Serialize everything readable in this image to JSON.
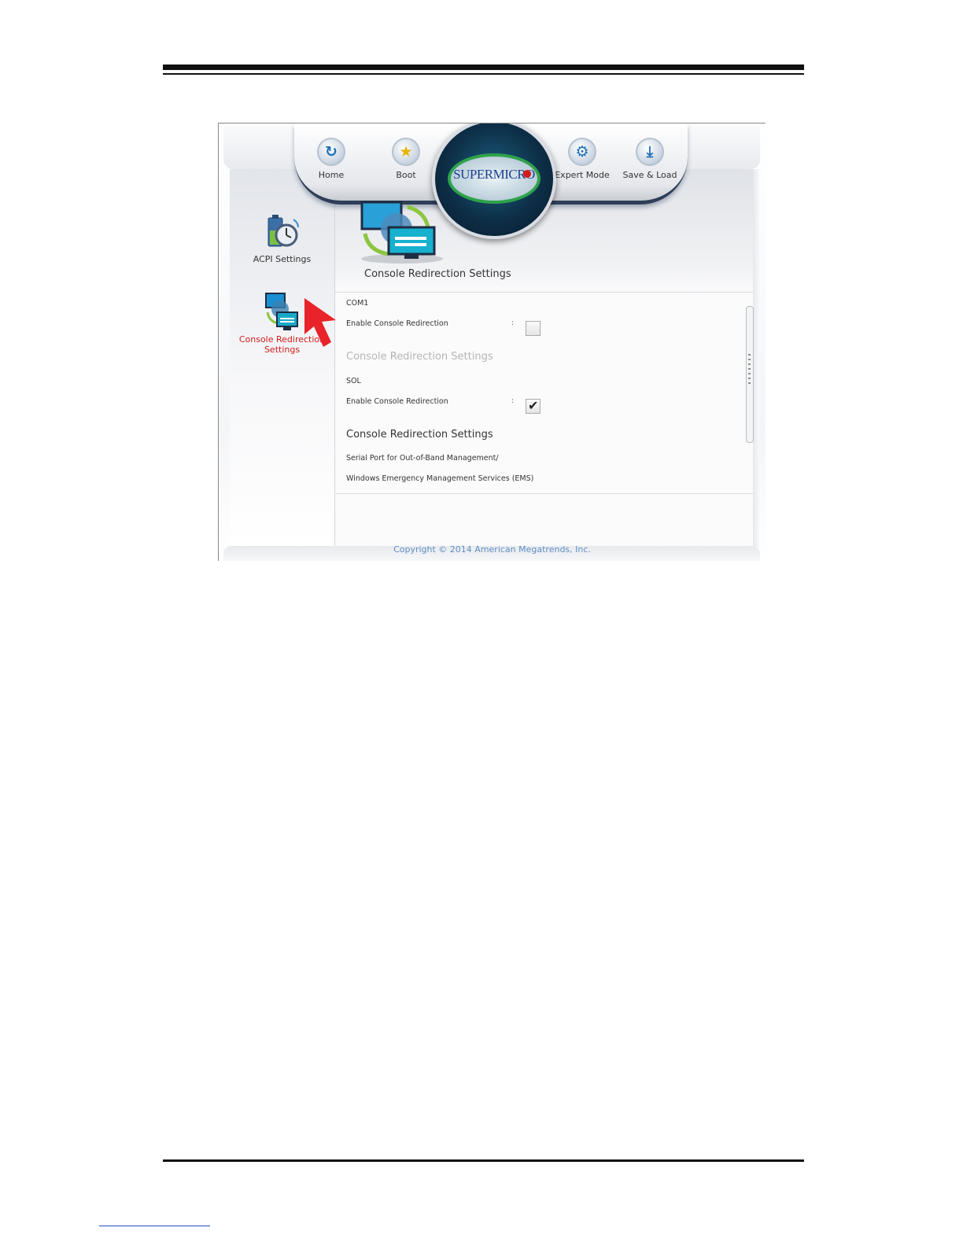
{
  "toolbar": {
    "items": [
      {
        "label": "Home",
        "icon": "refresh-icon"
      },
      {
        "label": "Boot",
        "icon": "star-icon"
      },
      {
        "label": "Expert Mode",
        "icon": "gear-icon"
      },
      {
        "label": "Save & Load",
        "icon": "download-icon"
      }
    ],
    "logo_text": "SUPERMICRO"
  },
  "sidebar": {
    "items": [
      {
        "label": "ACPI Settings",
        "icon": "battery-clock-icon",
        "active": false
      },
      {
        "label": "Console Redirection Settings",
        "icon": "monitors-icon",
        "active": true
      }
    ]
  },
  "header": {
    "title": "Console Redirection Settings",
    "icon": "monitors-icon"
  },
  "settings": {
    "com1": {
      "section_label": "COM1",
      "option_label": "Enable Console Redirection",
      "separator": ":",
      "checked": false,
      "subsection_title": "Console Redirection Settings"
    },
    "sol": {
      "section_label": "SOL",
      "option_label": "Enable Console Redirection",
      "separator": ":",
      "checked": true,
      "subsection_title": "Console Redirection Settings"
    },
    "ems": {
      "line1": "Serial Port for Out-of-Band Management/",
      "line2": "Windows Emergency Management Services (EMS)"
    }
  },
  "footer": {
    "copyright": "Copyright © 2014 American Megatrends, Inc."
  },
  "colors": {
    "active_nav": "#d21b1b",
    "copyright": "#5e8fc4",
    "annotation_arrow": "#e8242a"
  }
}
